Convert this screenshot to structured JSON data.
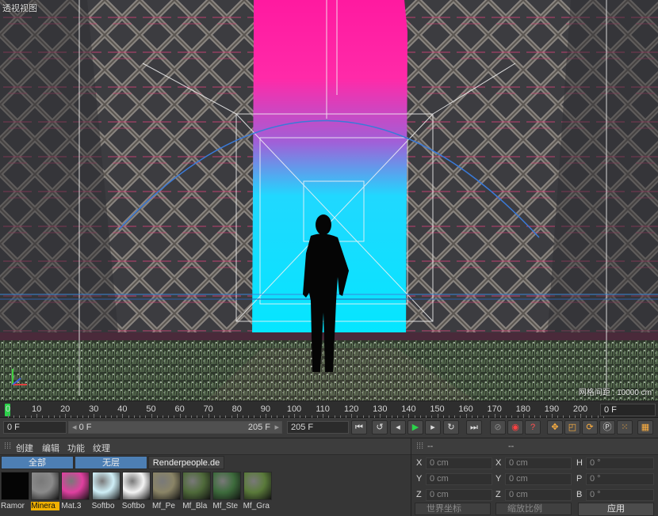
{
  "viewport": {
    "title": "透视视图",
    "grid_spacing": "网格间距 : 10000 cm"
  },
  "timeline": {
    "ticks": [
      "0",
      "10",
      "20",
      "30",
      "40",
      "50",
      "60",
      "70",
      "80",
      "90",
      "100",
      "110",
      "120",
      "130",
      "140",
      "150",
      "160",
      "170",
      "180",
      "190",
      "200"
    ],
    "current_frame": "0 F"
  },
  "transport": {
    "start_field": "0 F",
    "range_start": "0 F",
    "range_end": "205 F",
    "end_field": "205 F",
    "icons": [
      "go-to-start-icon",
      "prev-key-icon",
      "play-back-icon",
      "play-forward-icon",
      "next-key-icon",
      "go-to-end-icon",
      "record-icon",
      "autokey-icon",
      "help-icon",
      "move-icon",
      "scale-icon",
      "rotate-icon",
      "param-icon",
      "grid-icon"
    ]
  },
  "material_panel": {
    "menu": [
      "创建",
      "编辑",
      "功能",
      "纹理"
    ],
    "filters": [
      "全部",
      "无层",
      "Renderpeople.de"
    ],
    "materials": [
      {
        "label": "Ramor",
        "color": "#050505"
      },
      {
        "label": "Minera",
        "color": "#8a8a8a",
        "selected": true
      },
      {
        "label": "Mat.3",
        "color": "#e040a0"
      },
      {
        "label": "Softbo",
        "color": "#cfeff7"
      },
      {
        "label": "Softbo",
        "color": "#f4f4f4"
      },
      {
        "label": "Mf_Pe",
        "color": "#8a8466"
      },
      {
        "label": "Mf_Bla",
        "color": "#4f6a3a"
      },
      {
        "label": "Mf_Ste",
        "color": "#3d6b3c"
      },
      {
        "label": "Mf_Gra",
        "color": "#5a7a3a"
      }
    ]
  },
  "coordinates": {
    "header_labels": [
      "--",
      "--"
    ],
    "col1": {
      "axes": [
        "X",
        "Y",
        "Z"
      ],
      "values": [
        "0 cm",
        "0 cm",
        "0 cm"
      ]
    },
    "col2": {
      "axes": [
        "X",
        "Y",
        "Z"
      ],
      "values": [
        "0 cm",
        "0 cm",
        "0 cm"
      ]
    },
    "col3": {
      "axes": [
        "H",
        "P",
        "B"
      ],
      "values": [
        "0 °",
        "0 °",
        "0 °"
      ]
    },
    "world_select": "世界坐标",
    "scale_select": "缩放比例",
    "apply": "应用"
  },
  "colors": {
    "accent": "#2bd34a",
    "magenta": "#ff1aa0",
    "cyan": "#00e0ff",
    "selected_filter": "#3b6da0",
    "selected_material": "#f0b000"
  }
}
